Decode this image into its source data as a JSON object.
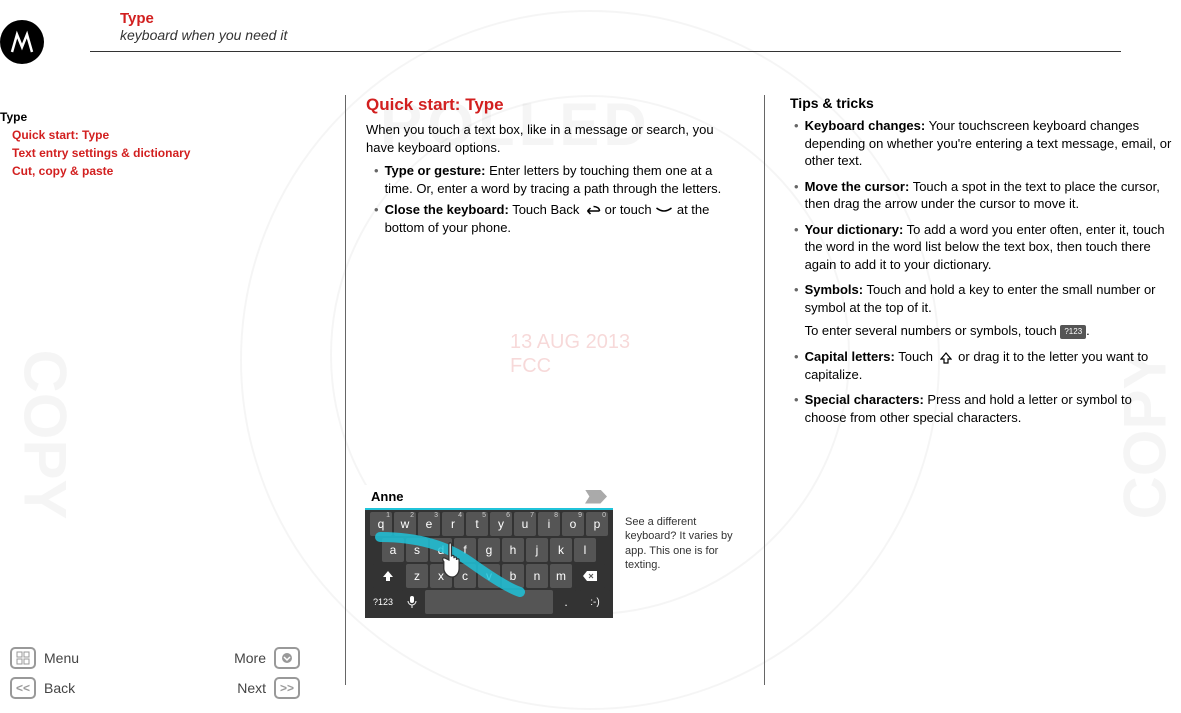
{
  "header": {
    "title": "Type",
    "subtitle": "keyboard when you need it"
  },
  "sidebar": {
    "section": "Type",
    "links": [
      "Quick start: Type",
      "Text entry settings & dictionary",
      "Cut, copy & paste"
    ]
  },
  "watermark_date": {
    "line1": "13 AUG 2013",
    "line2": "FCC"
  },
  "center": {
    "heading": "Quick start: Type",
    "intro": "When you touch a text box, like in a message or search, you have keyboard options.",
    "bullets": [
      {
        "bold": "Type or gesture:",
        "rest": " Enter letters by touching them one at a time. Or, enter a word by tracing a path through the letters."
      },
      {
        "bold": "Close the keyboard:",
        "rest_before": " Touch Back ",
        "rest_mid": " or touch ",
        "rest_after": " at the bottom of your phone."
      }
    ],
    "keyboard_input": "Anne",
    "keyboard_note": "See a different keyboard? It varies by app. This one is for texting.",
    "row1": [
      "q",
      "w",
      "e",
      "r",
      "t",
      "y",
      "u",
      "i",
      "o",
      "p"
    ],
    "row1_nums": [
      "1",
      "2",
      "3",
      "4",
      "5",
      "6",
      "7",
      "8",
      "9",
      "0"
    ],
    "row2": [
      "a",
      "s",
      "d",
      "f",
      "g",
      "h",
      "j",
      "k",
      "l"
    ],
    "row3": [
      "z",
      "x",
      "c",
      "v",
      "b",
      "n",
      "m"
    ],
    "row4_sym": "?123",
    "row4_period": ".",
    "row4_smile": ":-)"
  },
  "right": {
    "heading": "Tips & tricks",
    "bullets": [
      {
        "bold": "Keyboard changes:",
        "rest": " Your touchscreen keyboard changes depending on whether you're entering a text message, email, or other text."
      },
      {
        "bold": "Move the cursor:",
        "rest": " Touch a spot in the text to place the cursor, then drag the arrow under the cursor to move it."
      },
      {
        "bold": "Your dictionary:",
        "rest": " To add a word you enter often, enter it, touch the word in the word list below the text box, then touch there again to add it to your dictionary."
      },
      {
        "bold": "Symbols:",
        "rest": " Touch and hold a key to enter the small number or symbol at the top of it.",
        "para2_before": "To enter several numbers or symbols, touch ",
        "para2_key": "?123",
        "para2_after": "."
      },
      {
        "bold": "Capital letters:",
        "rest_before": " Touch ",
        "rest_after": " or drag it to the letter you want to capitalize."
      },
      {
        "bold": "Special characters:",
        "rest": " Press and hold a letter or symbol to choose from other special characters."
      }
    ]
  },
  "nav": {
    "menu": "Menu",
    "more": "More",
    "back": "Back",
    "next": "Next"
  }
}
